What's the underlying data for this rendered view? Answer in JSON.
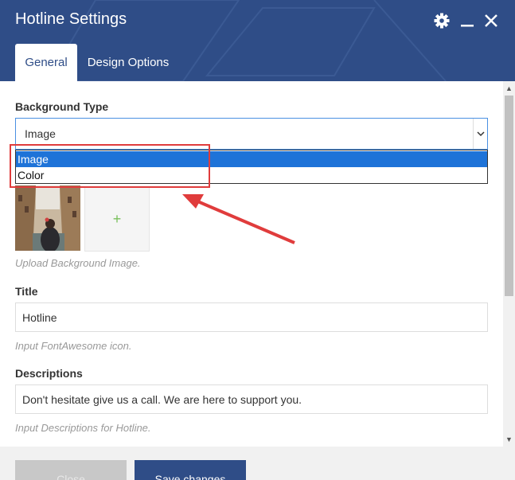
{
  "window": {
    "title": "Hotline Settings",
    "icons": [
      "gear-icon",
      "minimize-icon",
      "close-icon"
    ]
  },
  "tabs": [
    {
      "label": "General",
      "active": true
    },
    {
      "label": "Design Options",
      "active": false
    }
  ],
  "background_type": {
    "label": "Background Type",
    "selected": "Image",
    "options": [
      "Image",
      "Color"
    ],
    "highlighted_option": "Image"
  },
  "upload": {
    "add_symbol": "+",
    "help": "Upload Background Image."
  },
  "title_field": {
    "label": "Title",
    "value": "Hotline",
    "help": "Input FontAwesome icon."
  },
  "descriptions_field": {
    "label": "Descriptions",
    "value": "Don't hesitate give us a call. We are here to support you.",
    "help": "Input Descriptions for Hotline."
  },
  "buttons": {
    "close": "Close",
    "save": "Save changes"
  },
  "colors": {
    "header": "#2f4d87",
    "accent": "#4a90e2",
    "annotation": "#e03c3c",
    "selected_option": "#1e73d8"
  }
}
